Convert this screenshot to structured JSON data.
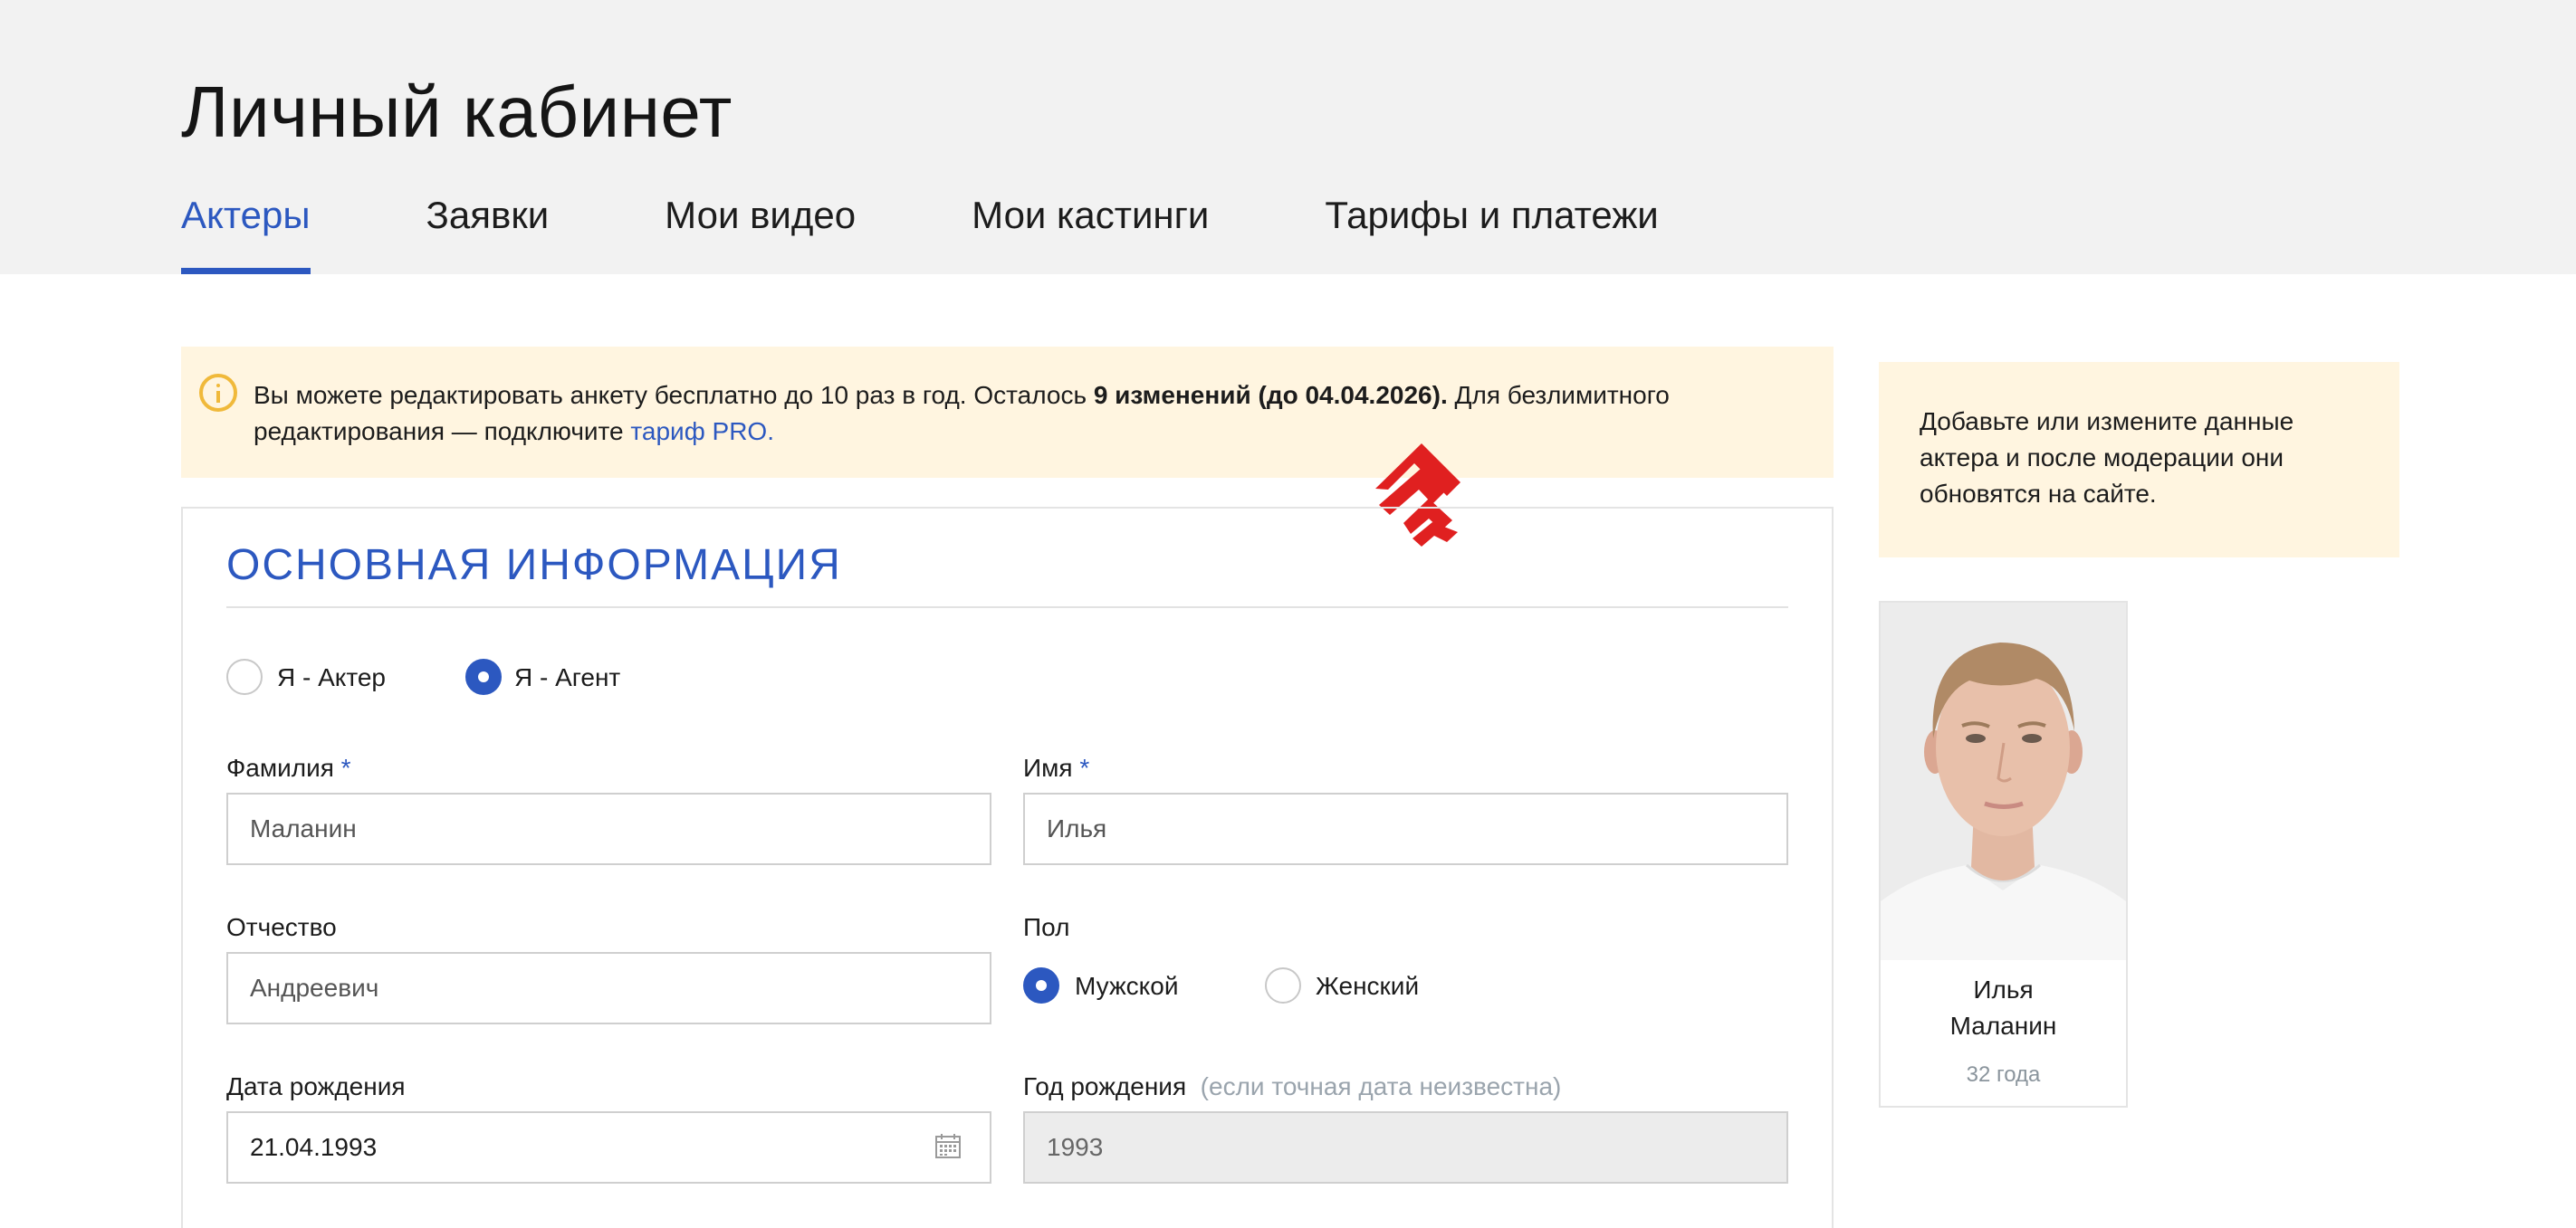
{
  "page": {
    "title": "Личный кабинет"
  },
  "tabs": [
    {
      "label": "Актеры",
      "active": true
    },
    {
      "label": "Заявки",
      "active": false
    },
    {
      "label": "Мои видео",
      "active": false
    },
    {
      "label": "Мои кастинги",
      "active": false
    },
    {
      "label": "Тарифы и платежи",
      "active": false
    }
  ],
  "notice": {
    "icon": "info-icon",
    "text_before": "Вы можете редактировать анкету бесплатно до 10 раз в год. Осталось ",
    "bold": "9 изменений (до 04.04.2026).",
    "text_after": " Для безлимитного редактирования — подключите ",
    "link": "тариф PRO."
  },
  "form": {
    "section_title": "ОСНОВНАЯ ИНФОРМАЦИЯ",
    "role": {
      "options": [
        {
          "label": "Я - Актер",
          "checked": false
        },
        {
          "label": "Я - Агент",
          "checked": true
        }
      ]
    },
    "last_name": {
      "label": "Фамилия",
      "required_mark": "*",
      "value": "Маланин"
    },
    "first_name": {
      "label": "Имя",
      "required_mark": "*",
      "value": "Илья"
    },
    "patronymic": {
      "label": "Отчество",
      "value": "Андреевич"
    },
    "gender": {
      "label": "Пол",
      "options": [
        {
          "label": "Мужской",
          "checked": true
        },
        {
          "label": "Женский",
          "checked": false
        }
      ]
    },
    "birth_date": {
      "label": "Дата рождения",
      "value": "21.04.1993",
      "icon": "calendar-icon"
    },
    "birth_year": {
      "label": "Год рождения",
      "hint": "(если точная дата неизвестна)",
      "value": "1993"
    }
  },
  "side_info": {
    "text": "Добавьте или измените данные актера и после модерации они обновятся на сайте."
  },
  "profile": {
    "first_name": "Илья",
    "last_name": "Маланин",
    "age": "32 года"
  },
  "colors": {
    "accent": "#2c58c0",
    "notice_bg": "#fff5e0",
    "header_bg": "#f2f2f2",
    "arrow": "#e02020"
  }
}
